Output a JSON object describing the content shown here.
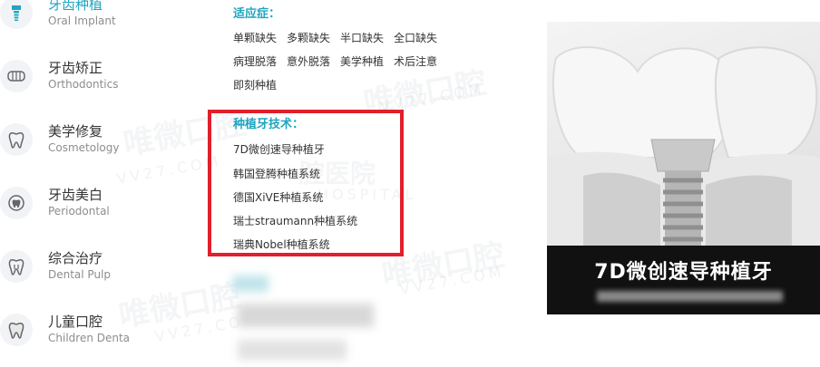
{
  "nav": {
    "items": [
      {
        "cn": "牙齿种植",
        "en": "Oral Implant",
        "icon": "implant-icon"
      },
      {
        "cn": "牙齿矫正",
        "en": "Orthodontics",
        "icon": "braces-icon"
      },
      {
        "cn": "美学修复",
        "en": "Cosmetology",
        "icon": "tooth-icon"
      },
      {
        "cn": "牙齿美白",
        "en": "Periodontal",
        "icon": "whitening-icon"
      },
      {
        "cn": "综合治疗",
        "en": "Dental Pulp",
        "icon": "tooth-root-icon"
      },
      {
        "cn": "儿童口腔",
        "en": "Children Denta",
        "icon": "child-tooth-icon"
      }
    ]
  },
  "indications": {
    "title": "适应症：",
    "rows": [
      [
        "单颗缺失",
        "多颗缺失",
        "半口缺失",
        "全口缺失"
      ],
      [
        "病理脱落",
        "意外脱落",
        "美学种植",
        "术后注意"
      ],
      [
        "即刻种植"
      ]
    ]
  },
  "techniques": {
    "title": "种植牙技术：",
    "items": [
      "7D微创速导种植牙",
      "韩国登腾种植系统",
      "德国XiVE种植系统",
      "瑞士straumann种植系统",
      "瑞典Nobel种植系统"
    ]
  },
  "photo": {
    "caption": "7D微创速导种植牙"
  },
  "watermark": {
    "brand": "唯微口腔",
    "domain": "VV27.COM",
    "hospital_cn": "腔医院",
    "hospital_en": "HOSPITAL"
  },
  "colors": {
    "accent": "#1fa5c0",
    "highlight_box": "#e0202b",
    "caption_bg": "#111111"
  }
}
